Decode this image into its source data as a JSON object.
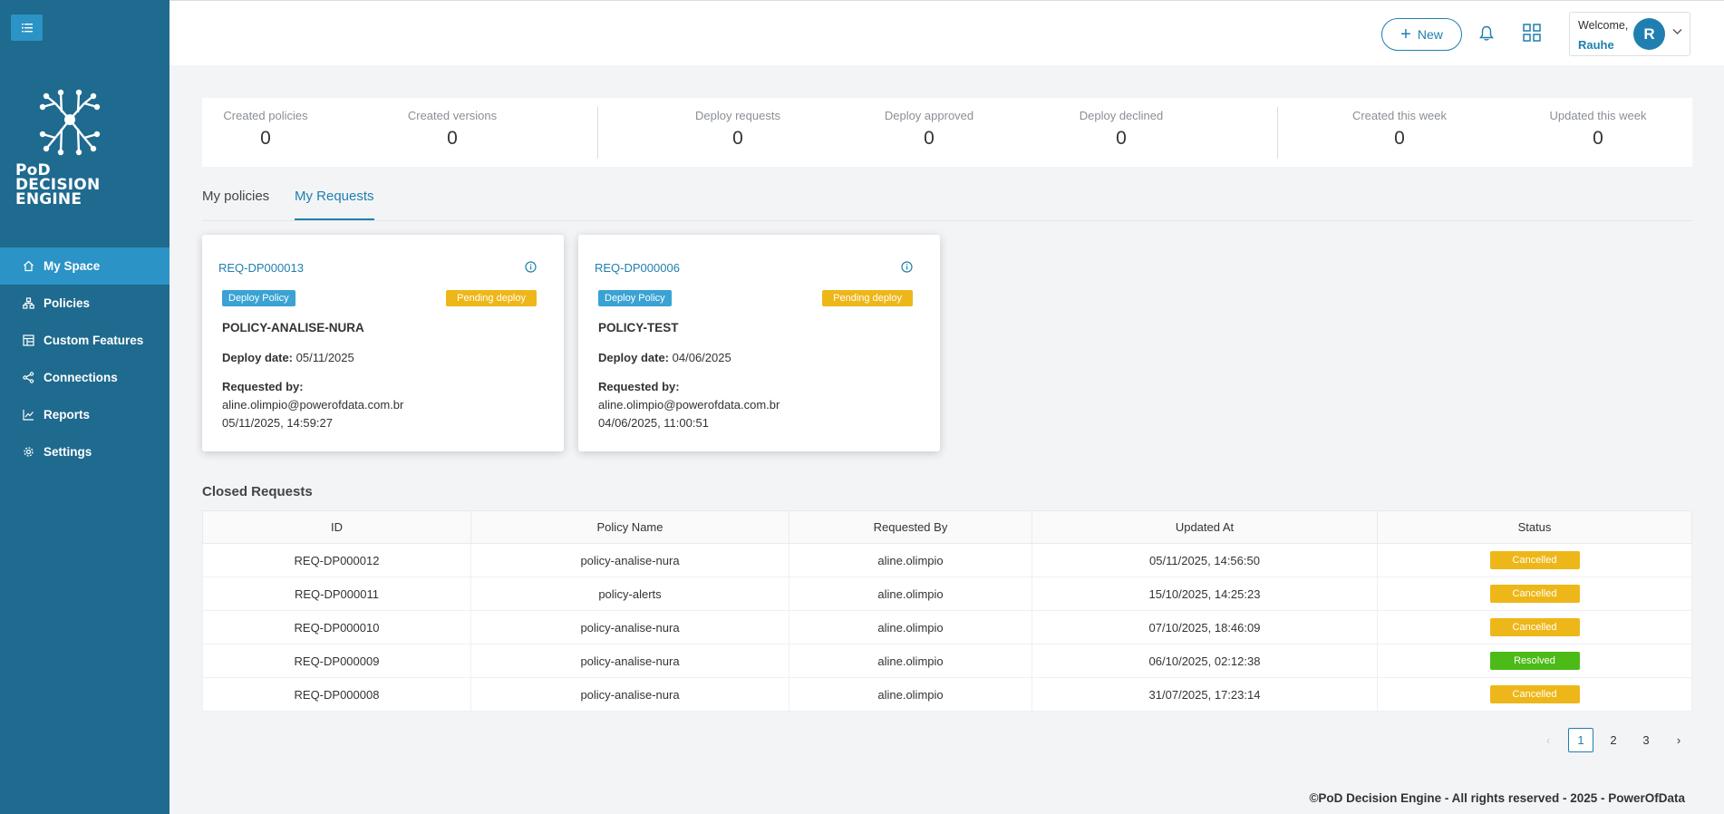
{
  "app": {
    "logo_text_line1": "PoD",
    "logo_text_line2": "DECISION",
    "logo_text_line3": "ENGINE"
  },
  "sidebar": {
    "items": [
      {
        "label": "My Space",
        "icon": "home-icon"
      },
      {
        "label": "Policies",
        "icon": "hierarchy-icon"
      },
      {
        "label": "Custom Features",
        "icon": "table-icon"
      },
      {
        "label": "Connections",
        "icon": "share-icon"
      },
      {
        "label": "Reports",
        "icon": "line-chart-icon"
      },
      {
        "label": "Settings",
        "icon": "gear-icon"
      }
    ]
  },
  "header": {
    "new_label": "New",
    "welcome": "Welcome,",
    "username": "Rauhe",
    "avatar_initial": "R"
  },
  "stats": [
    {
      "label": "Created policies",
      "value": "0"
    },
    {
      "label": "Created versions",
      "value": "0"
    },
    {
      "label": "Deploy requests",
      "value": "0"
    },
    {
      "label": "Deploy approved",
      "value": "0"
    },
    {
      "label": "Deploy declined",
      "value": "0"
    },
    {
      "label": "Created this week",
      "value": "0"
    },
    {
      "label": "Updated this week",
      "value": "0"
    }
  ],
  "tabs": [
    {
      "label": "My policies",
      "active": false
    },
    {
      "label": "My Requests",
      "active": true
    }
  ],
  "cards": [
    {
      "id": "REQ-DP000013",
      "type": "Deploy Policy",
      "status": "Pending deploy",
      "policy": "POLICY-ANALISE-NURA",
      "deploy_label": "Deploy date:",
      "deploy_date": "05/11/2025",
      "requested_label": "Requested by:",
      "email": "aline.olimpio@powerofdata.com.br",
      "requested_at": "05/11/2025, 14:59:27"
    },
    {
      "id": "REQ-DP000006",
      "type": "Deploy Policy",
      "status": "Pending deploy",
      "policy": "POLICY-TEST",
      "deploy_label": "Deploy date:",
      "deploy_date": "04/06/2025",
      "requested_label": "Requested by:",
      "email": "aline.olimpio@powerofdata.com.br",
      "requested_at": "04/06/2025, 11:00:51"
    }
  ],
  "closed": {
    "title": "Closed Requests",
    "columns": [
      "ID",
      "Policy Name",
      "Requested By",
      "Updated At",
      "Status"
    ],
    "rows": [
      {
        "id": "REQ-DP000012",
        "policy": "policy-analise-nura",
        "by": "aline.olimpio",
        "updated": "05/11/2025, 14:56:50",
        "status": "Cancelled"
      },
      {
        "id": "REQ-DP000011",
        "policy": "policy-alerts",
        "by": "aline.olimpio",
        "updated": "15/10/2025, 14:25:23",
        "status": "Cancelled"
      },
      {
        "id": "REQ-DP000010",
        "policy": "policy-analise-nura",
        "by": "aline.olimpio",
        "updated": "07/10/2025, 18:46:09",
        "status": "Cancelled"
      },
      {
        "id": "REQ-DP000009",
        "policy": "policy-analise-nura",
        "by": "aline.olimpio",
        "updated": "06/10/2025, 02:12:38",
        "status": "Resolved"
      },
      {
        "id": "REQ-DP000008",
        "policy": "policy-analise-nura",
        "by": "aline.olimpio",
        "updated": "31/07/2025, 17:23:14",
        "status": "Cancelled"
      }
    ]
  },
  "pagination": {
    "prev": "‹",
    "pages": [
      "1",
      "2",
      "3"
    ],
    "current": "1",
    "next": "›"
  },
  "footer": "©PoD Decision Engine - All rights reserved - 2025 - PowerOfData",
  "colors": {
    "sidebar": "#1f6a8f",
    "accent": "#1f7fb0",
    "pending": "#eeb719",
    "resolved": "#4cbb17"
  }
}
